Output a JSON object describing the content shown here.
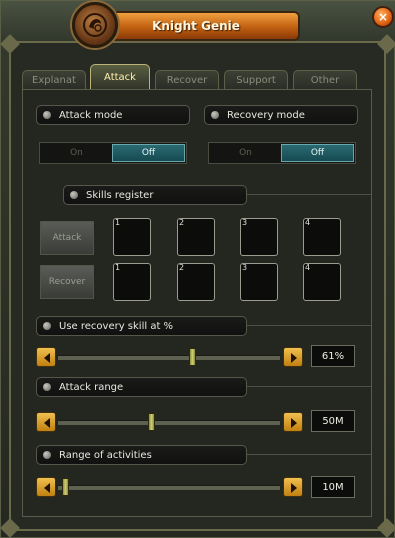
{
  "window": {
    "title": "Knight Genie",
    "close_label": "×"
  },
  "tabs": [
    {
      "label": "Explanat"
    },
    {
      "label": "Attack"
    },
    {
      "label": "Recover"
    },
    {
      "label": "Support"
    },
    {
      "label": "Other"
    }
  ],
  "active_tab": "Attack",
  "attack_mode": {
    "label": "Attack mode",
    "on": "On",
    "off": "Off",
    "selected": "Off"
  },
  "recovery_mode": {
    "label": "Recovery mode",
    "on": "On",
    "off": "Off",
    "selected": "Off"
  },
  "skills_register": {
    "label": "Skills register",
    "attack_button": "Attack",
    "recover_button": "Recover",
    "attack_slots": [
      "1",
      "2",
      "3",
      "4"
    ],
    "recover_slots": [
      "1",
      "2",
      "3",
      "4"
    ]
  },
  "recovery_skill": {
    "label": "Use recovery skill at %",
    "value": "61%",
    "level": 0.61
  },
  "attack_range": {
    "label": "Attack range",
    "value": "50M",
    "level": 0.42
  },
  "activities_range": {
    "label": "Range of activities",
    "value": "10M",
    "level": 0.02
  },
  "colors": {
    "accent": "#f0a040",
    "toggle_on": "#1f5a62"
  },
  "icons": {
    "close": "close-icon",
    "emblem": "knight-emblem-icon",
    "left": "arrow-left-icon",
    "right": "arrow-right-icon"
  }
}
